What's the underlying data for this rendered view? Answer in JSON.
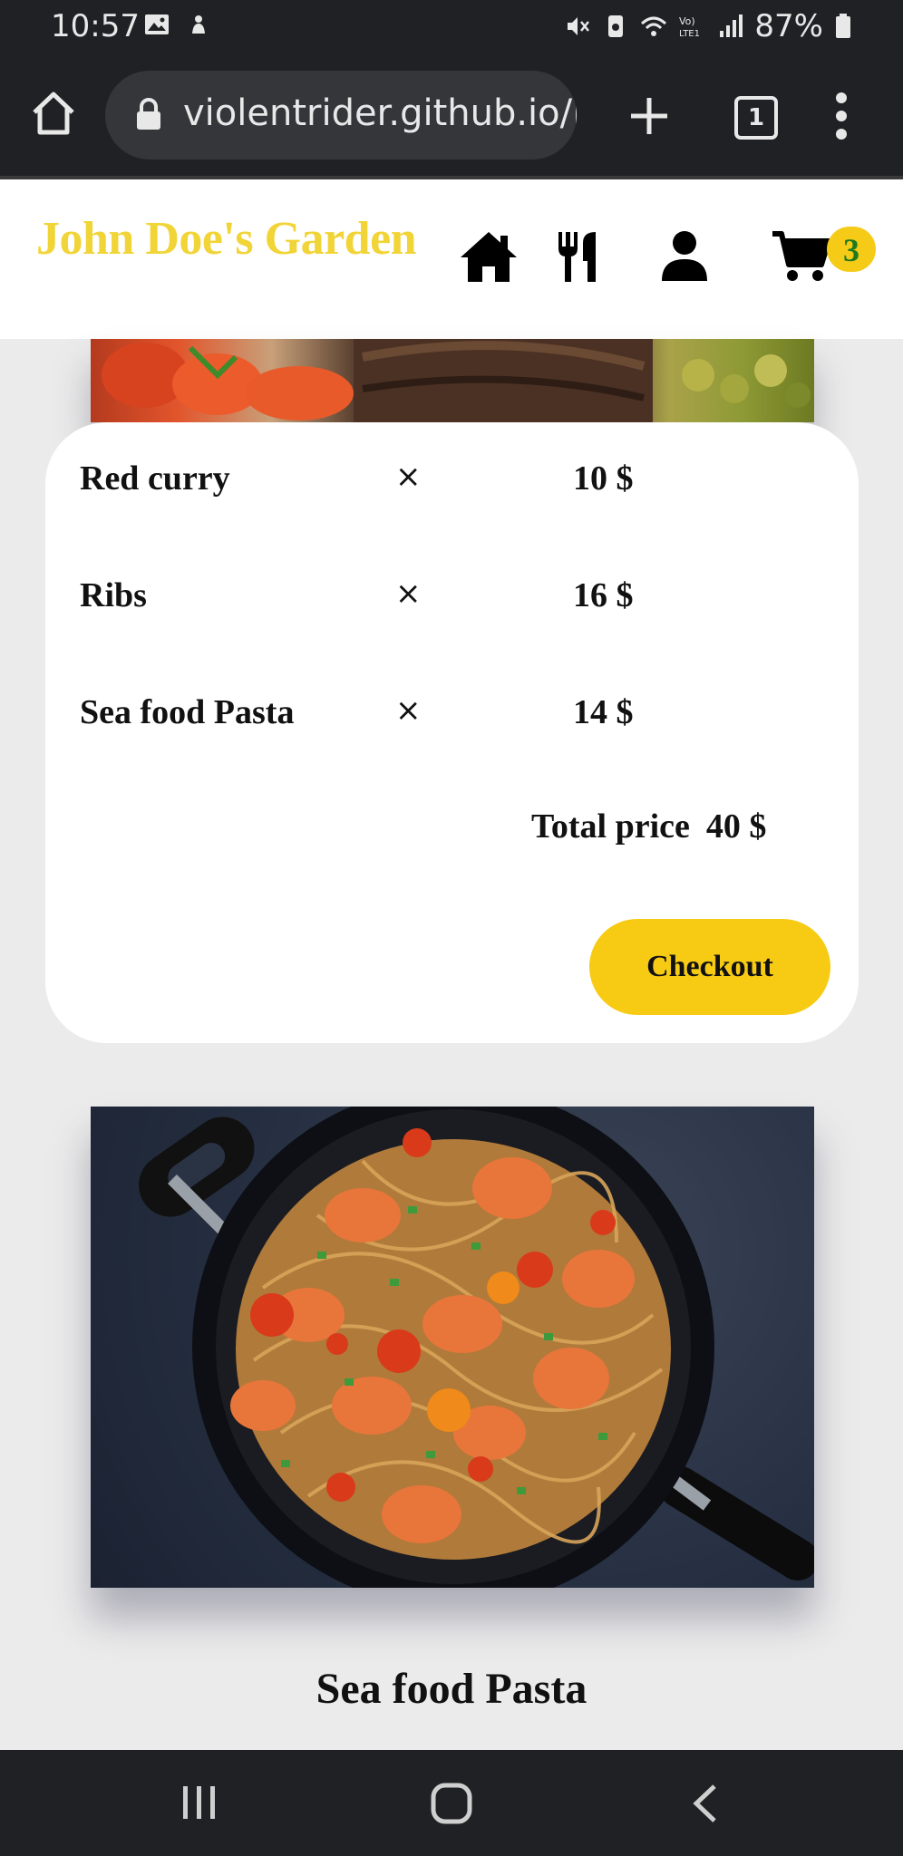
{
  "status_bar": {
    "time": "10:57",
    "battery": "87%",
    "icons": [
      "image-icon",
      "notification-icon",
      "mute-icon",
      "recycle-icon",
      "wifi-icon",
      "volte-icon",
      "signal-icon",
      "battery-icon"
    ]
  },
  "browser": {
    "url": "violentrider.github.io/F",
    "tab_count": "1"
  },
  "site": {
    "brand": "John Doe's Garden",
    "cart_count": "3",
    "accent_color": "#f5cb18",
    "brand_color": "#f1d437"
  },
  "cart": {
    "items": [
      {
        "name": "Red curry",
        "remove": "×",
        "price": "10 $"
      },
      {
        "name": "Ribs",
        "remove": "×",
        "price": "16 $"
      },
      {
        "name": "Sea food Pasta",
        "remove": "×",
        "price": "14 $"
      }
    ],
    "total_label": "Total price",
    "total_value": "40 $",
    "checkout_label": "Checkout"
  },
  "dish": {
    "title": "Sea food Pasta"
  }
}
